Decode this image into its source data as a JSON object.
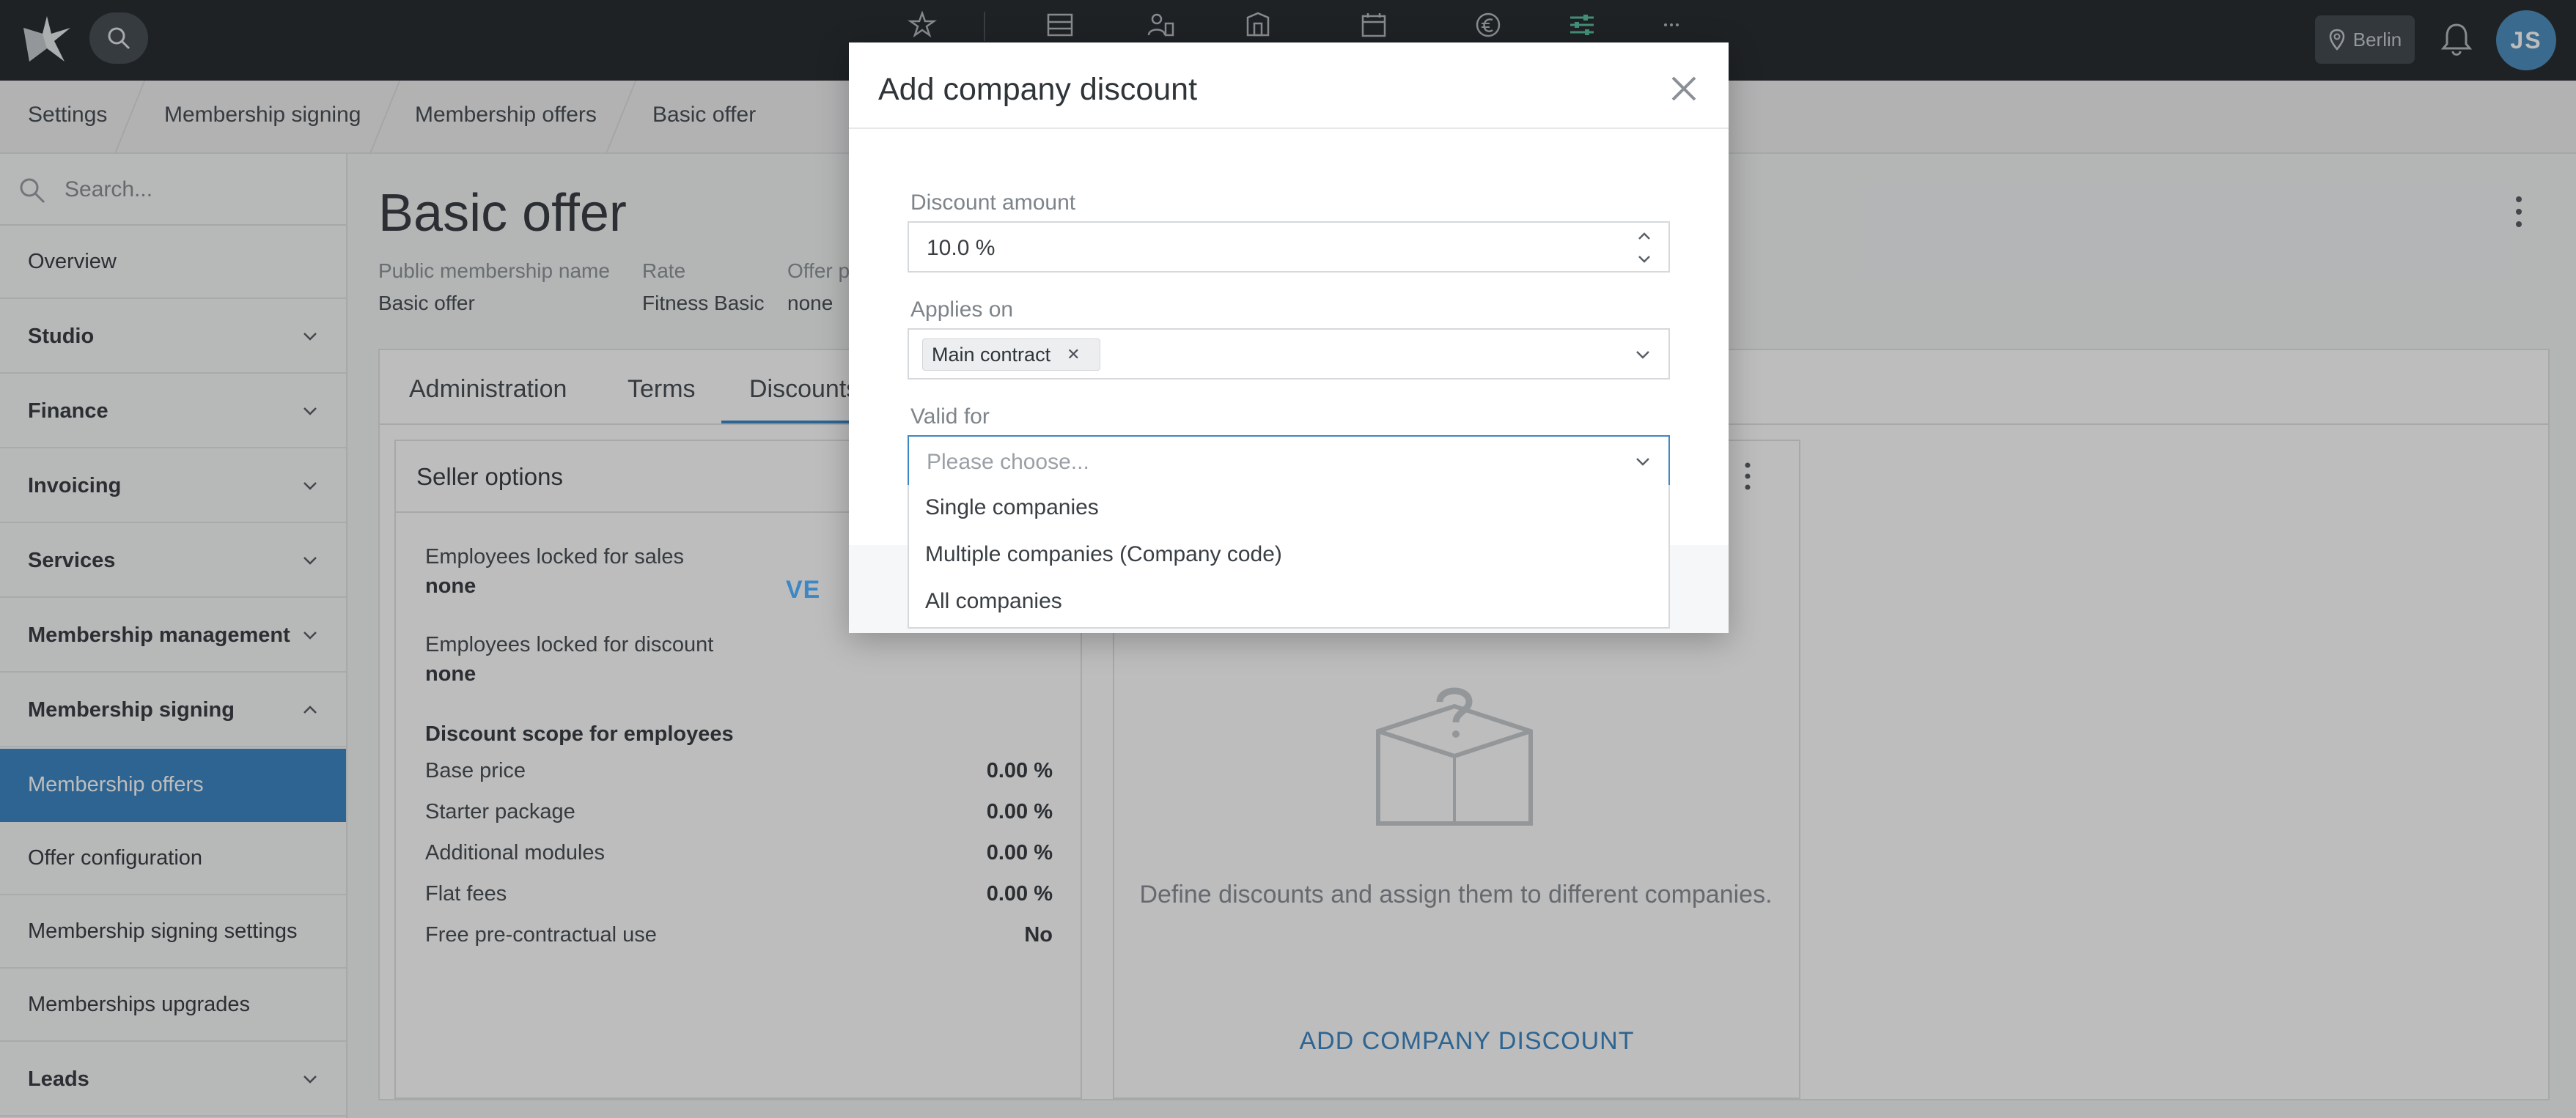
{
  "topbar": {
    "location": "Berlin",
    "user_initials": "JS",
    "nav_icons": [
      "star-icon",
      "layout-icon",
      "member-icon",
      "building-icon",
      "calendar-icon",
      "euro-icon",
      "sliders-icon",
      "more-icon"
    ],
    "active_icon_color": "#5cc2a0"
  },
  "breadcrumb": [
    "Settings",
    "Membership signing",
    "Membership offers",
    "Basic offer"
  ],
  "sidebar": {
    "search_placeholder": "Search...",
    "items": [
      {
        "label": "Overview"
      },
      {
        "label": "Studio"
      },
      {
        "label": "Finance"
      },
      {
        "label": "Invoicing"
      },
      {
        "label": "Services"
      },
      {
        "label": "Membership management"
      },
      {
        "label": "Membership signing"
      },
      {
        "label": "Membership offers"
      },
      {
        "label": "Offer configuration"
      },
      {
        "label": "Membership signing settings"
      },
      {
        "label": "Memberships upgrades"
      },
      {
        "label": "Leads"
      }
    ],
    "active_color": "#3d87c4"
  },
  "page": {
    "title": "Basic offer",
    "meta": [
      {
        "label": "Public membership name",
        "value": "Basic offer"
      },
      {
        "label": "Rate",
        "value": "Fitness Basic"
      },
      {
        "label": "Offer p",
        "value": "none"
      }
    ]
  },
  "tabs": [
    "Administration",
    "Terms",
    "Discounts"
  ],
  "seller_options": {
    "title": "Seller options",
    "employees_locked_sales_label": "Employees locked for sales",
    "employees_locked_sales_value": "none",
    "employees_locked_discount_label": "Employees locked for discount",
    "employees_locked_discount_value": "none",
    "scope_title": "Discount scope for employees",
    "rows": [
      {
        "label": "Base price",
        "value": "0.00 %"
      },
      {
        "label": "Starter package",
        "value": "0.00 %"
      },
      {
        "label": "Additional modules",
        "value": "0.00 %"
      },
      {
        "label": "Flat fees",
        "value": "0.00 %"
      },
      {
        "label": "Free pre-contractual use",
        "value": "No"
      }
    ]
  },
  "company_discounts": {
    "empty_text": "Define discounts and assign them to different companies.",
    "add_button": "ADD COMPANY DISCOUNT"
  },
  "modal": {
    "title": "Add company discount",
    "discount_amount_label": "Discount amount",
    "discount_amount_value": "10.0 %",
    "applies_on_label": "Applies on",
    "applies_on_chip": "Main contract",
    "valid_for_label": "Valid for",
    "valid_for_placeholder": "Please choose...",
    "valid_for_options": [
      "Single companies",
      "Multiple companies (Company code)",
      "All companies"
    ],
    "save_label_visible": "VE"
  }
}
